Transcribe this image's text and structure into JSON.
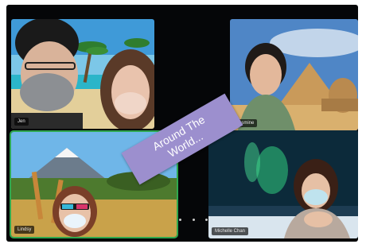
{
  "participants": [
    {
      "name": "Jen"
    },
    {
      "name": "Jasmine"
    },
    {
      "name": "Lindsy"
    },
    {
      "name": "Michelle Chan"
    }
  ],
  "banner": {
    "line1": "Around The",
    "line2": "World..."
  },
  "colors": {
    "banner": "#9c8fce",
    "active_speaker_border": "#2fa84f",
    "frame": "#050608"
  },
  "active_speaker": "Lindsy"
}
